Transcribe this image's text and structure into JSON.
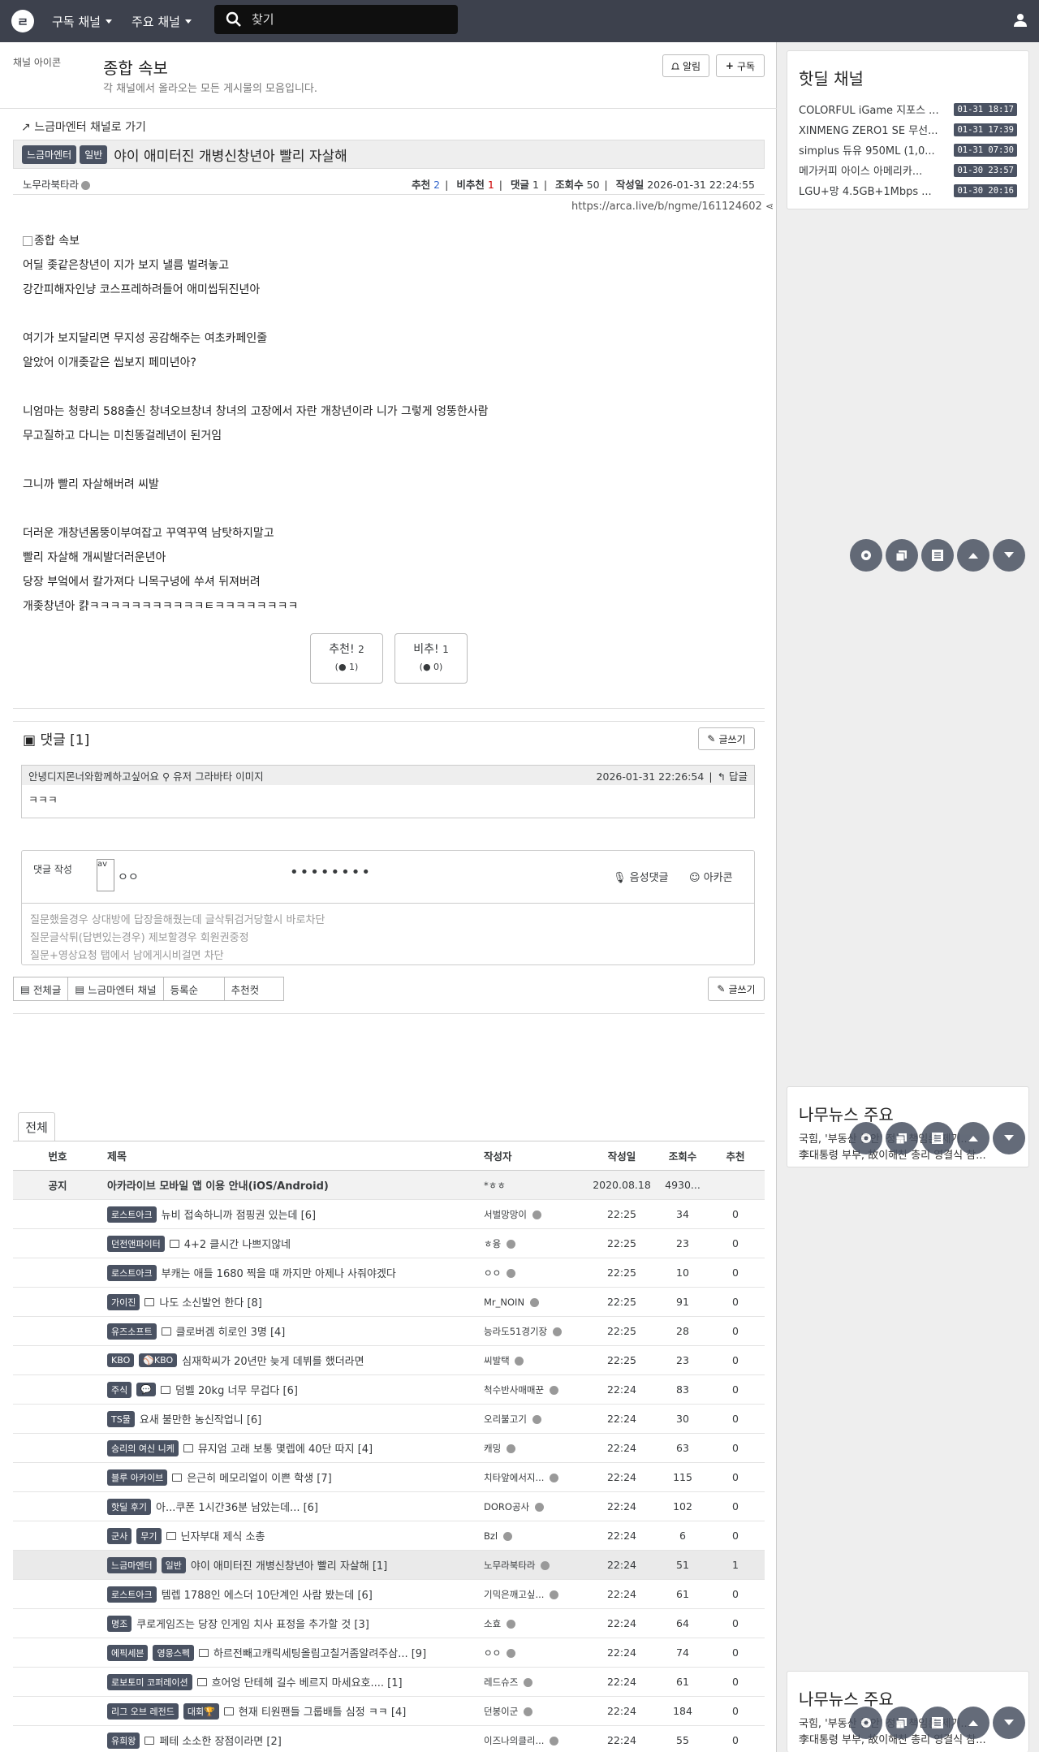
{
  "nav": {
    "logo": "ㄹ",
    "menu1": "구독 채널",
    "menu2": "주요 채널",
    "search_placeholder": "찾기"
  },
  "channel": {
    "icon_alt": "채널 아이콘",
    "title": "종합 속보",
    "description": "각 채널에서 올라오는 모든 게시물의 모음입니다.",
    "notify_label": "알림",
    "subscribe_label": "구독"
  },
  "post": {
    "back_link": "느금마엔터 채널로 가기",
    "badge1": "느금마엔터",
    "badge2": "일반",
    "title": "야이 애미터진 개병신창년아 빨리 자살해",
    "author": "노무라북타라",
    "info": {
      "votes_label": "추천",
      "votes": "2",
      "downvotes_label": "비추천",
      "downvotes": "1",
      "comments_label": "댓글",
      "comments": "1",
      "views_label": "조회수",
      "views": "50",
      "date_label": "작성일",
      "date": "2026-01-31 22:24:55"
    },
    "url": "https://arca.live/b/ngme/161124602",
    "image_alt": "종합 속보",
    "lines": [
      "어딜 좆같은창년이 지가 보지 낼름 벌려놓고",
      "강간피해자인냥 코스프레하려들어 애미씹뒤진년아",
      "",
      "여기가 보지달리면 무지성 공감해주는 여초카페인줄",
      "알았어 이개좆같은 씹보지 페미년아?",
      "",
      "니엄마는 청량리 588출신 창녀오브창녀 창녀의 고장에서 자란 개창년이라 니가 그렇게 엉뚱한사람",
      "무고질하고 다니는 미친똥걸레년이 된거임",
      "",
      "그니까 빨리 자살해버려 씨발",
      "",
      "더러운 개창년몸뚱이부여잡고 꾸역꾸역 남탓하지말고",
      "빨리 자살해 개씨발더러운년아",
      "당장 부엌에서 칼가져다 니목구녕에 쑤셔 뒤져버려",
      "개좆창년아 캵ㅋㅋㅋㅋㅋㅋㅋㅋㅋㅋㅋㅌㅋㅋㅋㅋㅋㅋㅋㅋ"
    ],
    "upvote": {
      "label": "추천!",
      "count": "2",
      "sub": "1"
    },
    "downvote": {
      "label": "비추!",
      "count": "1",
      "sub": "0"
    }
  },
  "comments": {
    "header": "댓글 [1]",
    "write_btn": "글쓰기",
    "items": [
      {
        "author": "안녕디지몬너와함께하고싶어요",
        "avatar_alt": "유저 그라바타 이미지",
        "date": "2026-01-31 22:26:54",
        "reply": "답글",
        "body": "ㅋㅋㅋ"
      }
    ],
    "form": {
      "label": "댓글 작성",
      "avatar_alt": "av",
      "name": "ㅇㅇ",
      "password": "••••••••",
      "voice": "음성댓글",
      "emoticon": "아카콘",
      "placeholder_lines": [
        "질문했을경우 상대방에 답장을해줬는데 글삭튀검거당할시 바로차단",
        "질문글삭튀(답변있는경우) 제보할경우 회원권중정",
        "질문+영상요청 탭에서 남에게시비걸면 차단"
      ]
    }
  },
  "filters": {
    "all": "전체글",
    "channel": "느금마엔터 채널",
    "order": "등록순",
    "best": "추천컷",
    "write": "글쓰기"
  },
  "list": {
    "tab": "전체",
    "headers": {
      "no": "번호",
      "title": "제목",
      "author": "작성자",
      "date": "작성일",
      "views": "조회수",
      "votes": "추천"
    },
    "notice": {
      "no": "공지",
      "title": "아카라이브 모바일 앱 이용 안내(iOS/Android)",
      "author": "*ㅎㅎ",
      "date": "2020.08.18",
      "views": "4930...",
      "votes": ""
    },
    "rows": [
      {
        "badges": [
          "로스트아크"
        ],
        "img": false,
        "title": "뉴비 접속하니까 점핑권 있는데 [6]",
        "author": "서벌망망이",
        "date": "22:25",
        "views": "34",
        "votes": "0"
      },
      {
        "badges": [
          "던전앤파이터"
        ],
        "img": true,
        "title": "4+2 클시간 나쁘지않네",
        "author": "ㅎ융",
        "date": "22:25",
        "views": "23",
        "votes": "0"
      },
      {
        "badges": [
          "로스트아크"
        ],
        "img": false,
        "title": "부캐는 애들 1680 찍을 때 까지만 아제나 사줘야겠다",
        "author": "ㅇㅇ",
        "date": "22:25",
        "views": "10",
        "votes": "0"
      },
      {
        "badges": [
          "가이진"
        ],
        "img": true,
        "title": "나도 소신발언 한다 [8]",
        "author": "Mr_NOIN",
        "date": "22:25",
        "views": "91",
        "votes": "0"
      },
      {
        "badges": [
          "유즈소프트"
        ],
        "img": true,
        "title": "클로버겜 히로인 3명 [4]",
        "author": "능라도51경기장",
        "date": "22:25",
        "views": "28",
        "votes": "0"
      },
      {
        "badges": [
          "KBO",
          "⚾KBO"
        ],
        "img": false,
        "title": "심재학씨가 20년만 늦게 데뷔를 했더라면",
        "author": "씨발택",
        "date": "22:25",
        "views": "23",
        "votes": "0"
      },
      {
        "badges": [
          "주식",
          "💬"
        ],
        "img": true,
        "title": "덤벨 20kg 너무 무겁다 [6]",
        "author": "척수반사매매꾼",
        "date": "22:24",
        "views": "83",
        "votes": "0"
      },
      {
        "badges": [
          "TS물"
        ],
        "img": false,
        "title": "요새 불만한 농신작업니 [6]",
        "author": "오리불고기",
        "date": "22:24",
        "views": "30",
        "votes": "0"
      },
      {
        "badges": [
          "승리의 여신 니케"
        ],
        "img": true,
        "title": "뮤지엄 고래 보통 몇렙에 40단 따지 [4]",
        "author": "캐밍",
        "date": "22:24",
        "views": "63",
        "votes": "0"
      },
      {
        "badges": [
          "블루 아카이브"
        ],
        "img": true,
        "title": "은근히 메모리얼이 이쁜 학생 [7]",
        "author": "치타앞에서지...",
        "date": "22:24",
        "views": "115",
        "votes": "0"
      },
      {
        "badges": [
          "핫딜 후기"
        ],
        "img": false,
        "title": "아...쿠폰 1시간36분 남았는데... [6]",
        "author": "DORO공사",
        "date": "22:24",
        "views": "102",
        "votes": "0"
      },
      {
        "badges": [
          "군사",
          "무기"
        ],
        "img": true,
        "title": "닌자부대 제식 소총",
        "author": "Bzl",
        "date": "22:24",
        "views": "6",
        "votes": "0"
      },
      {
        "badges": [
          "느금마엔터",
          "일반"
        ],
        "img": false,
        "title": "야이 애미터진 개병신창년아 빨리 자살해 [1]",
        "author": "노무라북타라",
        "date": "22:24",
        "views": "51",
        "votes": "1",
        "current": true
      },
      {
        "badges": [
          "로스트아크"
        ],
        "img": false,
        "title": "템렙 1788인 에스더 10단계인 사람 봤는데 [6]",
        "author": "기믹은깨고싶...",
        "date": "22:24",
        "views": "61",
        "votes": "0"
      },
      {
        "badges": [
          "명조"
        ],
        "img": false,
        "title": "쿠로게임즈는 당장 인게임 치사 표정을 추가할 것 [3]",
        "author": "소효",
        "date": "22:24",
        "views": "64",
        "votes": "0"
      },
      {
        "badges": [
          "에픽세븐",
          "영웅스펙"
        ],
        "img": true,
        "title": "하르전빼고캐릭세팅올림고칠거좀알려주삼... [9]",
        "author": "ㅇㅇ",
        "date": "22:24",
        "views": "74",
        "votes": "0"
      },
      {
        "badges": [
          "로보토미 코퍼레이션"
        ],
        "img": true,
        "title": "흐어엉 단테헤 길수 베르지 마세요호.... [1]",
        "author": "레드슈즈",
        "date": "22:24",
        "views": "61",
        "votes": "0"
      },
      {
        "badges": [
          "리그 오브 레전드",
          "대회🏆"
        ],
        "img": true,
        "title": "현재 티원팬들 그룹배틀 심정 ㅋㅋ [4]",
        "author": "던봉이군",
        "date": "22:24",
        "views": "184",
        "votes": "0"
      },
      {
        "badges": [
          "유희왕"
        ],
        "img": true,
        "title": "페테 소소한 장점이라면 [2]",
        "author": "이즈나의클리...",
        "date": "22:24",
        "views": "55",
        "votes": "0"
      }
    ]
  },
  "sidebar": {
    "hotdeal_title": "핫딜 채널",
    "hotdeals": [
      {
        "title": "COLORFUL iGame 지포스 ...",
        "time": "01-31 18:17"
      },
      {
        "title": "XINMENG ZERO1 SE 무선...",
        "time": "01-31 17:39"
      },
      {
        "title": "simplus 듀유 950ML (1,0...",
        "time": "01-31 07:30"
      },
      {
        "title": "메가커피 아이스 아메리카...",
        "time": "01-30 23:57"
      },
      {
        "title": "LGU+망 4.5GB+1Mbps ...",
        "time": "01-30 20:16"
      }
    ],
    "news_title": "나무뉴스 주요",
    "news_line1": "국힘, '부동산 불안' 정부 책임론 제기...",
    "news_line2": "李대통령 부부, 故이해찬 총리 영결식 참..."
  }
}
